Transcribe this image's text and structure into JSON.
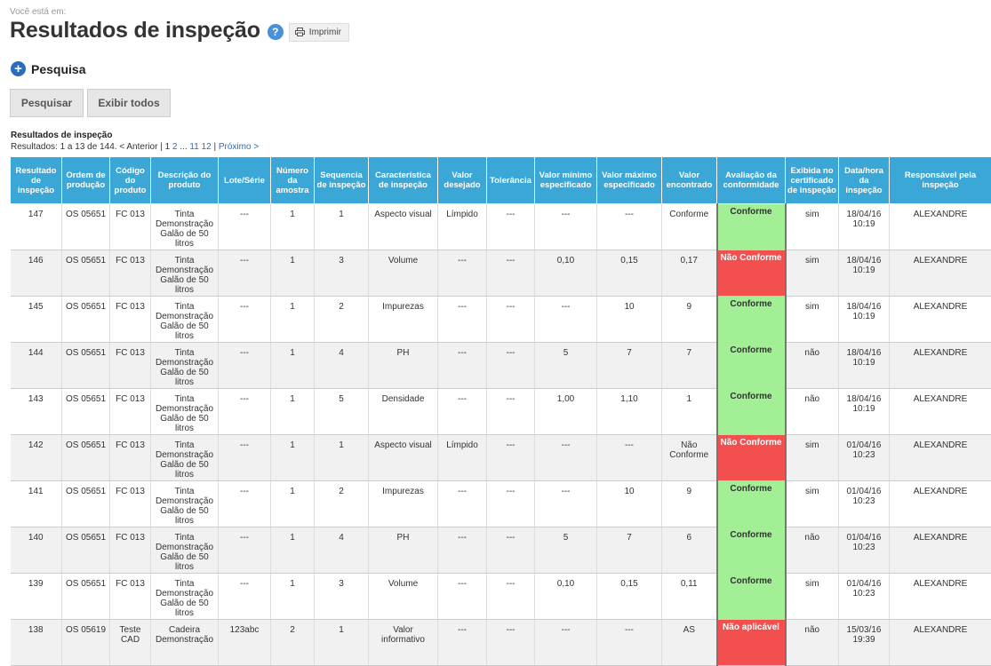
{
  "breadcrumb": "Você está em:",
  "page_title": "Resultados de inspeção",
  "help_label": "?",
  "print_label": "Imprimir",
  "search_toggle_label": "Pesquisa",
  "buttons": {
    "search": "Pesquisar",
    "show_all": "Exibir todos"
  },
  "results": {
    "caption": "Resultados de inspeção",
    "summary": "Resultados: 1 a 13 de 144.",
    "prev": "< Anterior",
    "sep1": "|",
    "page1": "1",
    "page2": "2",
    "ellipsis": "...",
    "page11": "11",
    "page12": "12",
    "sep2": "|",
    "next": "Próximo >"
  },
  "colors": {
    "header": "#3aa7d6",
    "conforme": "#a2ef96",
    "nao_conforme": "#f44f4f"
  },
  "table": {
    "headers": [
      "Resultado de inspeção",
      "Ordem de produção",
      "Código do produto",
      "Descrição do produto",
      "Lote/Série",
      "Número da amostra",
      "Sequencia de inspeção",
      "Característica de inspeção",
      "Valor desejado",
      "Tolerância",
      "Valor mínimo especificado",
      "Valor máximo especificado",
      "Valor encontrado",
      "Avaliação da conformidade",
      "Exibida no certificado de inspeção",
      "Data/hora da inspeção",
      "Responsável pela inspeção"
    ],
    "rows": [
      [
        "147",
        "OS 05651",
        "FC 013",
        "Tinta Demonstração Galão de 50 litros",
        "---",
        "1",
        "1",
        "Aspecto visual",
        "Límpido",
        "---",
        "---",
        "---",
        "Conforme",
        "Conforme",
        "sim",
        "18/04/16 10:19",
        "ALEXANDRE"
      ],
      [
        "146",
        "OS 05651",
        "FC 013",
        "Tinta Demonstração Galão de 50 litros",
        "---",
        "1",
        "3",
        "Volume",
        "---",
        "---",
        "0,10",
        "0,15",
        "0,17",
        "Não Conforme",
        "sim",
        "18/04/16 10:19",
        "ALEXANDRE"
      ],
      [
        "145",
        "OS 05651",
        "FC 013",
        "Tinta Demonstração Galão de 50 litros",
        "---",
        "1",
        "2",
        "Impurezas",
        "---",
        "---",
        "---",
        "10",
        "9",
        "Conforme",
        "sim",
        "18/04/16 10:19",
        "ALEXANDRE"
      ],
      [
        "144",
        "OS 05651",
        "FC 013",
        "Tinta Demonstração Galão de 50 litros",
        "---",
        "1",
        "4",
        "PH",
        "---",
        "---",
        "5",
        "7",
        "7",
        "Conforme",
        "não",
        "18/04/16 10:19",
        "ALEXANDRE"
      ],
      [
        "143",
        "OS 05651",
        "FC 013",
        "Tinta Demonstração Galão de 50 litros",
        "---",
        "1",
        "5",
        "Densidade",
        "---",
        "---",
        "1,00",
        "1,10",
        "1",
        "Conforme",
        "não",
        "18/04/16 10:19",
        "ALEXANDRE"
      ],
      [
        "142",
        "OS 05651",
        "FC 013",
        "Tinta Demonstração Galão de 50 litros",
        "---",
        "1",
        "1",
        "Aspecto visual",
        "Límpido",
        "---",
        "---",
        "---",
        "Não Conforme",
        "Não Conforme",
        "sim",
        "01/04/16 10:23",
        "ALEXANDRE"
      ],
      [
        "141",
        "OS 05651",
        "FC 013",
        "Tinta Demonstração Galão de 50 litros",
        "---",
        "1",
        "2",
        "Impurezas",
        "---",
        "---",
        "---",
        "10",
        "9",
        "Conforme",
        "sim",
        "01/04/16 10:23",
        "ALEXANDRE"
      ],
      [
        "140",
        "OS 05651",
        "FC 013",
        "Tinta Demonstração Galão de 50 litros",
        "---",
        "1",
        "4",
        "PH",
        "---",
        "---",
        "5",
        "7",
        "6",
        "Conforme",
        "não",
        "01/04/16 10:23",
        "ALEXANDRE"
      ],
      [
        "139",
        "OS 05651",
        "FC 013",
        "Tinta Demonstração Galão de 50 litros",
        "---",
        "1",
        "3",
        "Volume",
        "---",
        "---",
        "0,10",
        "0,15",
        "0,11",
        "Conforme",
        "sim",
        "01/04/16 10:23",
        "ALEXANDRE"
      ],
      [
        "138",
        "OS 05619",
        "Teste CAD",
        "Cadeira Demonstração",
        "123abc",
        "2",
        "1",
        "Valor informativo",
        "---",
        "---",
        "---",
        "---",
        "AS",
        "Não aplicável",
        "não",
        "15/03/16 19:39",
        "ALEXANDRE"
      ]
    ],
    "row_status": [
      "conforme",
      "nao_conforme",
      "conforme",
      "conforme",
      "conforme",
      "nao_conforme",
      "conforme",
      "conforme",
      "conforme",
      "nao_aplicavel"
    ]
  }
}
